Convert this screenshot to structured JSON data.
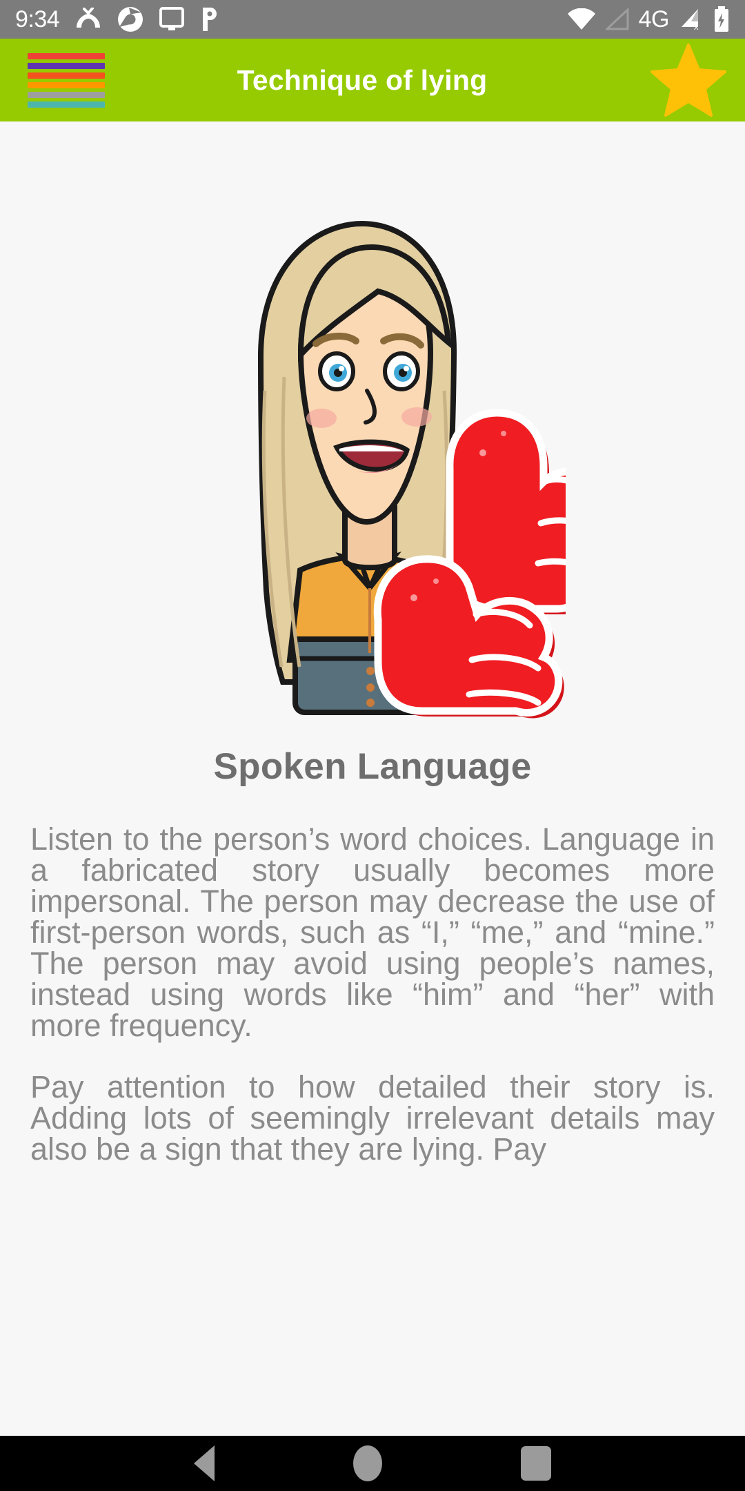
{
  "status_bar": {
    "time": "9:34",
    "network_label": "4G",
    "left_icons": [
      "missed-call-icon",
      "chrome-icon",
      "cast-screen-icon",
      "pandora-p-icon"
    ],
    "right_icons": [
      "wifi-icon",
      "signal-triangle-icon",
      "signal-no-sim-icon",
      "battery-charging-icon"
    ],
    "background_color": "#7c7c7c"
  },
  "app_bar": {
    "title": "Technique of lying",
    "background_color": "#95cb00",
    "menu_icon": "hamburger-menu-icon",
    "menu_bar_colors": [
      "#ef4136",
      "#5e35b1",
      "#f4511e",
      "#ff9800",
      "#9e9e9e",
      "#4db6ac"
    ],
    "favorite_icon": "star-icon",
    "favorite_color": "#ffc107"
  },
  "content": {
    "image_name": "woman-with-foam-thumbs-up-illustration",
    "caption": "Spoken Language",
    "paragraphs": [
      "Listen to the person’s word choices. Language in a fabricated story usually becomes more impersonal. The person may decrease the use of first-person words, such as “I,” “me,” and “mine.” The person may avoid using people’s names, instead using words like “him” and “her” with more frequency.",
      " Pay attention to how detailed their story is. Adding lots of seemingly irrelevant details may also be a sign that they are lying. Pay"
    ],
    "text_color": "#8b8b8b",
    "background_color": "#f7f7f7"
  },
  "nav_bar": {
    "background_color": "#000000",
    "buttons": [
      "back-button",
      "home-button",
      "recent-apps-button"
    ]
  }
}
